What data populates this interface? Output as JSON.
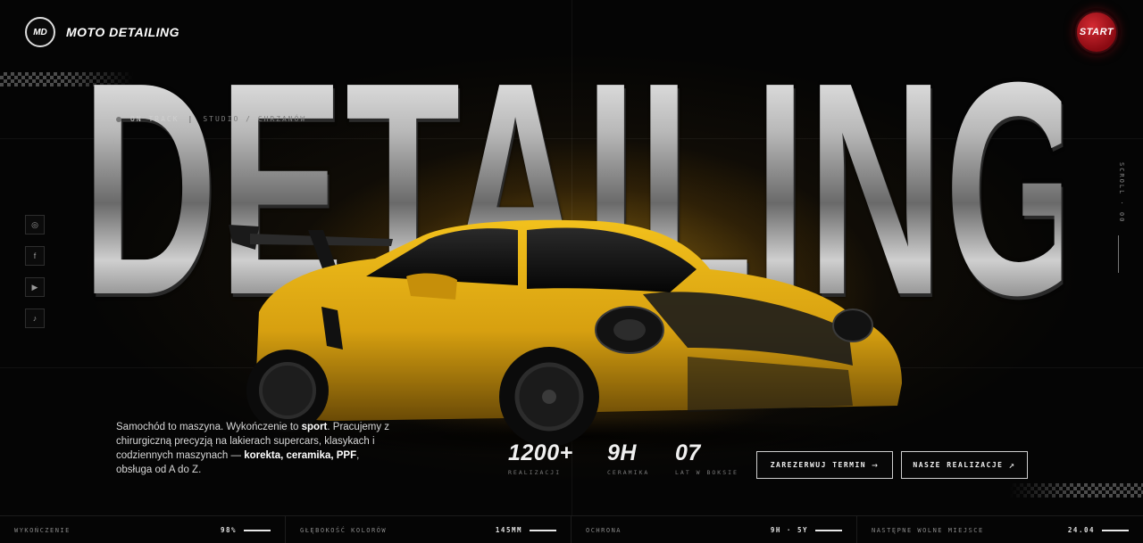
{
  "brand": {
    "logo_badge": "MD",
    "name": "MOTO DETAILING"
  },
  "header": {
    "start_label": "START"
  },
  "hero": {
    "title": "DETAILING",
    "status": {
      "indicator": "ON TRACK",
      "studio": "STUDIO / CHRZANÓW"
    },
    "scroll_label": "SCROLL · 00",
    "intro": {
      "part1": "Samochód to maszyna. Wykończenie to ",
      "bold1": "sport",
      "part2": ". Pracujemy z chirurgiczną precyzją na lakierach supercars, klasykach i codziennych maszynach — ",
      "bold2": "korekta, ceramika, PPF",
      "part3": ", obsługa od A do Z."
    }
  },
  "social": [
    {
      "name": "instagram",
      "icon": "instagram-icon",
      "glyph": "◎"
    },
    {
      "name": "facebook",
      "icon": "facebook-icon",
      "glyph": "f"
    },
    {
      "name": "youtube",
      "icon": "youtube-icon",
      "glyph": "▶"
    },
    {
      "name": "tiktok",
      "icon": "tiktok-icon",
      "glyph": "♪"
    }
  ],
  "stats": [
    {
      "value": "1200+",
      "label": "REALIZACJI"
    },
    {
      "value": "9H",
      "label": "CERAMIKA"
    },
    {
      "value": "07",
      "label": "LAT W BOKSIE"
    }
  ],
  "cta": {
    "book_label": "ZAREZERWUJ TERMIN",
    "book_arrow": "→",
    "works_label": "NASZE REALIZACJE",
    "works_arrow": "↗"
  },
  "bottom_bar": [
    {
      "label": "WYKOŃCZENIE",
      "value": "98%"
    },
    {
      "label": "GŁĘBOKOŚĆ KOLORÓW",
      "value": "145MM"
    },
    {
      "label": "OCHRONA",
      "value": "9H · 5Y"
    },
    {
      "label": "NASTĘPNE WOLNE MIEJSCE",
      "value": "24.04"
    }
  ],
  "colors": {
    "background": "#050505",
    "accent_yellow": "#e0a418",
    "start_red": "#c4202a",
    "text": "#e8e8e8"
  }
}
